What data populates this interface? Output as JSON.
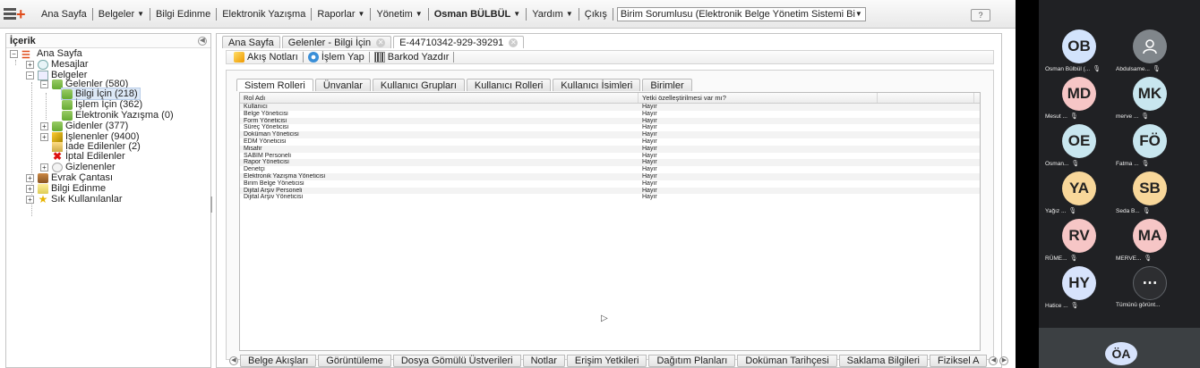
{
  "menubar": {
    "items": [
      "Ana Sayfa",
      "Belgeler",
      "Bilgi Edinme",
      "Elektronik Yazışma",
      "Raporlar",
      "Yönetim",
      "Osman BÜLBÜL",
      "Yardım",
      "Çıkış"
    ],
    "role_select": "Birim Sorumlusu (Elektronik Belge Yönetim Sistemi Bi",
    "help": "?"
  },
  "tree": {
    "header": "İçerik",
    "nodes": [
      {
        "label": "Ana Sayfa",
        "icon": "home-icon"
      },
      {
        "label": "Mesajlar",
        "icon": "message-icon"
      },
      {
        "label": "Belgeler",
        "icon": "document-icon"
      },
      {
        "label": "Gelenler (580)",
        "icon": "inbox-icon"
      },
      {
        "label": "Bilgi İçin (218)",
        "icon": "inbox-icon"
      },
      {
        "label": "İşlem İçin (362)",
        "icon": "inbox-icon"
      },
      {
        "label": "Elektronik Yazışma (0)",
        "icon": "inbox-icon"
      },
      {
        "label": "Gidenler (377)",
        "icon": "outbox-icon"
      },
      {
        "label": "İşlenenler (9400)",
        "icon": "pencil-icon"
      },
      {
        "label": "İade Edilenler (2)",
        "icon": "return-icon"
      },
      {
        "label": "İptal Edilenler",
        "icon": "cancel-icon"
      },
      {
        "label": "Gizlenenler",
        "icon": "hidden-icon"
      },
      {
        "label": "Evrak Çantası",
        "icon": "briefcase-icon"
      },
      {
        "label": "Bilgi Edinme",
        "icon": "folder-icon"
      },
      {
        "label": "Sık Kullanılanlar",
        "icon": "star-icon"
      }
    ]
  },
  "doc_tabs": [
    "Ana Sayfa",
    "Gelenler - Bilgi İçin",
    "E-44710342-929-39291"
  ],
  "toolbar": {
    "notes": "Akış Notları",
    "action": "İşlem Yap",
    "barcode": "Barkod Yazdır"
  },
  "inner_tabs": [
    "Sistem Rolleri",
    "Ünvanlar",
    "Kullanıcı Grupları",
    "Kullanıcı Rolleri",
    "Kullanıcı İsimleri",
    "Birimler"
  ],
  "grid": {
    "columns": [
      "Rol Adı",
      "Yetki özelleştirilmesi var mı?",
      ""
    ],
    "rows": [
      [
        "Kullanıcı",
        "Hayır"
      ],
      [
        "Belge Yöneticisi",
        "Hayır"
      ],
      [
        "Form Yöneticisi",
        "Hayır"
      ],
      [
        "Süreç Yöneticisi",
        "Hayır"
      ],
      [
        "Doküman Yöneticisi",
        "Hayır"
      ],
      [
        "EDM Yöneticisi",
        "Hayır"
      ],
      [
        "Misafir",
        "Hayır"
      ],
      [
        "SABİM Personeli",
        "Hayır"
      ],
      [
        "Rapor Yöneticisi",
        "Hayır"
      ],
      [
        "Denetçi",
        "Hayır"
      ],
      [
        "Elektronik Yazışma Yöneticisi",
        "Hayır"
      ],
      [
        "Birim Belge Yöneticisi",
        "Hayır"
      ],
      [
        "Dijital Arşiv Personeli",
        "Hayır"
      ],
      [
        "Dijital Arşiv Yöneticisi",
        "Hayır"
      ]
    ]
  },
  "bottom_tabs": [
    "Belge Akışları",
    "Görüntüleme",
    "Dosya Gömülü Üstverileri",
    "Notlar",
    "Erişim Yetkileri",
    "Dağıtım Planları",
    "Doküman Tarihçesi",
    "Saklama Bilgileri",
    "Fiziksel A"
  ],
  "meeting": {
    "participants": [
      {
        "initials": "OB",
        "name": "Osman Bülbül (...",
        "color": "#d2e3fc"
      },
      {
        "initials": "",
        "name": "Abdulsame...",
        "color": "#80868b",
        "icon": "user-icon"
      },
      {
        "initials": "MD",
        "name": "Mesut ...",
        "color": "#f6c6c6"
      },
      {
        "initials": "MK",
        "name": "merve ...",
        "color": "#c8e6ef"
      },
      {
        "initials": "OE",
        "name": "Osman...",
        "color": "#c8e6ef"
      },
      {
        "initials": "FÖ",
        "name": "Fatma ...",
        "color": "#c8e6ef"
      },
      {
        "initials": "YA",
        "name": "Yağız ...",
        "color": "#f8d79a"
      },
      {
        "initials": "SB",
        "name": "Seda B...",
        "color": "#f8d79a"
      },
      {
        "initials": "RV",
        "name": "RÜME...",
        "color": "#f6c6c6"
      },
      {
        "initials": "MA",
        "name": "MERVE...",
        "color": "#f6c6c6"
      },
      {
        "initials": "HY",
        "name": "Hatice ...",
        "color": "#d7e3fc"
      },
      {
        "initials": "⋯",
        "name": "Tümünü görünt...",
        "color": "#2d2e31"
      }
    ],
    "self_initials": "ÖA"
  }
}
